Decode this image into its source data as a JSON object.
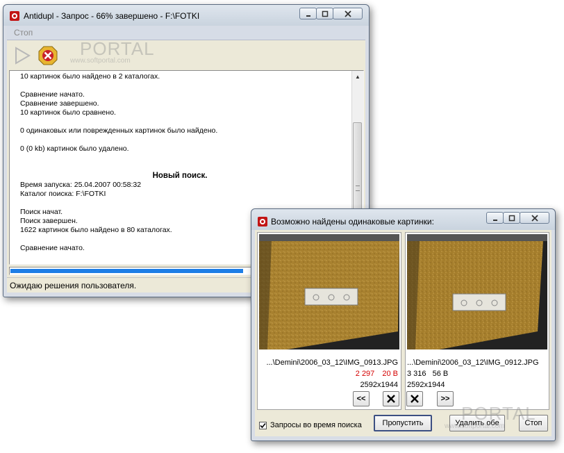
{
  "main_window": {
    "title": "Antidupl - Запрос - 66% завершено - F:\\FOTKI",
    "menu_stop": "Стоп",
    "log_lines": [
      "10 картинок было найдено в 2 каталогах.",
      "",
      "Сравнение начато.",
      "Сравнение завершено.",
      "10 картинок было сравнено.",
      "",
      "0 одинаковых или поврежденных картинок было найдено.",
      "",
      "0 (0 kb) картинок было удалено.",
      "",
      "",
      "Новый поиск.",
      "Время запуска: 25.04.2007 00:58:32",
      "Каталог поиска: F:\\FOTKI",
      "",
      "Поиск начат.",
      "Поиск завершен.",
      "1622 картинок было найдено в 80 каталогах.",
      "",
      "Сравнение начато."
    ],
    "progress": 0.66,
    "status_text": "Ожидаю решения пользователя."
  },
  "dup_dialog": {
    "title": "Возможно найдены одинаковые картинки:",
    "left": {
      "path": "...\\Demini\\2006_03_12\\IMG_0913.JPG",
      "size": "2 297",
      "unit": "20 B",
      "dims": "2592x1944"
    },
    "right": {
      "path": "...\\Demini\\2006_03_12\\IMG_0912.JPG",
      "size": "3 316",
      "unit": "56 B",
      "dims": "2592x1944"
    },
    "prev_label": "<<",
    "next_label": ">>",
    "checkbox_label": "Запросы во время поиска",
    "checkbox_checked": true,
    "skip_label": "Пропустить",
    "delete_both_label": "Удалить обе",
    "stop_label": "Стоп"
  },
  "watermark": {
    "brand": "PORTAL",
    "url": "www.softportal.com"
  },
  "colors": {
    "highlight_red": "#d40000",
    "progress_blue": "#1e7ee6",
    "photo_wall": "#a8812f"
  }
}
